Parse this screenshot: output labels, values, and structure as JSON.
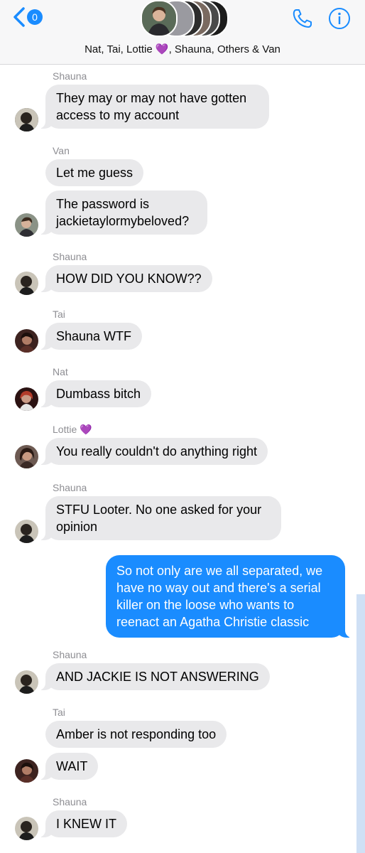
{
  "header": {
    "unread_count": "0",
    "group_name_prefix": "Nat, Tai, Lottie ",
    "heart": "💜",
    "group_name_suffix": ", Shauna, Others & Van",
    "accent_color": "#1a8cff"
  },
  "messages": [
    {
      "sender": "Shauna",
      "text": "They may or may not have gotten access to my account"
    },
    {
      "sender": "Van",
      "text": "Let me guess"
    },
    {
      "text": "The password is jackietaylormybeloved?"
    },
    {
      "sender": "Shauna",
      "text": "HOW DID YOU KNOW??"
    },
    {
      "sender": "Tai",
      "text": "Shauna WTF"
    },
    {
      "sender": "Nat",
      "text": "Dumbass bitch"
    },
    {
      "sender": "Lottie",
      "sender_heart": "💜",
      "text": "You really couldn't do anything right"
    },
    {
      "sender": "Shauna",
      "text": "STFU Looter. No one asked for your opinion"
    },
    {
      "outgoing": true,
      "text": "So not only are we all separated, we have no way out and there's a serial killer on the loose who wants to reenact an Agatha Christie classic"
    },
    {
      "sender": "Shauna",
      "text": "AND JACKIE IS NOT ANSWERING"
    },
    {
      "sender": "Tai",
      "text": "Amber is not responding too"
    },
    {
      "text": "WAIT"
    },
    {
      "sender": "Shauna",
      "text": "I KNEW IT"
    }
  ]
}
